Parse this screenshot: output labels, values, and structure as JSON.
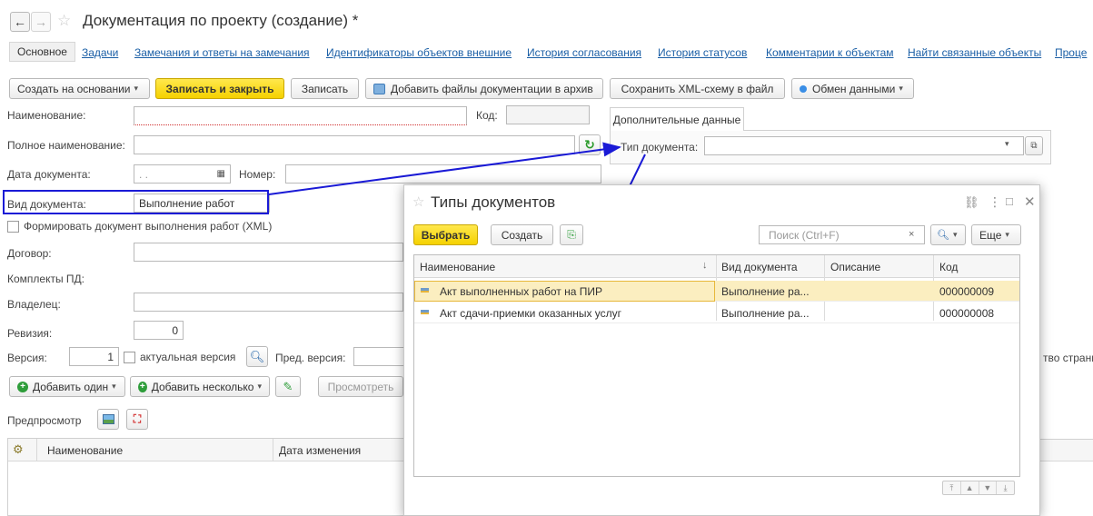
{
  "window": {
    "title": "Документация по проекту (создание) *",
    "back_glyph": "←",
    "forward_glyph": "→",
    "star_glyph": "☆"
  },
  "tabs": [
    {
      "label": "Основное",
      "active": true
    },
    {
      "label": "Задачи"
    },
    {
      "label": "Замечания и ответы на замечания"
    },
    {
      "label": "Идентификаторы объектов внешние"
    },
    {
      "label": "История согласования"
    },
    {
      "label": "История статусов"
    },
    {
      "label": "Комментарии к объектам"
    },
    {
      "label": "Найти связанные объекты"
    },
    {
      "label": "Проце"
    }
  ],
  "toolbar": {
    "create_based": "Создать на основании",
    "save_close": "Записать и закрыть",
    "save": "Записать",
    "add_files": "Добавить файлы документации в архив",
    "save_xml": "Сохранить XML-схему в файл",
    "exchange": "Обмен данными"
  },
  "form": {
    "name_label": "Наименование:",
    "code_label": "Код:",
    "full_name_label": "Полное наименование:",
    "doc_date_label": "Дата документа:",
    "doc_date_value": ". .",
    "number_label": "Номер:",
    "doc_kind_label": "Вид документа:",
    "doc_kind_value": "Выполнение работ",
    "form_xml_label": "Формировать документ выполнения работ (XML)",
    "contract_label": "Договор:",
    "kits_label": "Комплекты ПД:",
    "owner_label": "Владелец:",
    "revision_label": "Ревизия:",
    "revision_value": "0",
    "version_label": "Версия:",
    "version_value": "1",
    "actual_version_label": "актуальная версия",
    "prev_version_label": "Пред. версия:",
    "pages_label_partial": "тво страниц"
  },
  "additional": {
    "tab_label": "Дополнительные данные",
    "doc_type_label": "Тип документа:"
  },
  "files": {
    "add_one": "Добавить один",
    "add_several": "Добавить несколько",
    "view": "Просмотреть",
    "preview_label": "Предпросмотр",
    "col_name": "Наименование",
    "col_modified": "Дата изменения"
  },
  "dialog": {
    "title": "Типы документов",
    "select": "Выбрать",
    "create": "Создать",
    "search_placeholder": "Поиск (Ctrl+F)",
    "more": "Еще",
    "columns": [
      "Наименование",
      "Вид документа",
      "Описание",
      "Код"
    ],
    "rows": [
      {
        "name": "Акт выполненных работ на ПИР",
        "kind": "Выполнение ра...",
        "desc": "",
        "code": "000000009",
        "selected": true
      },
      {
        "name": "Акт сдачи-приемки оказанных услуг",
        "kind": "Выполнение ра...",
        "desc": "",
        "code": "000000008",
        "selected": false
      }
    ]
  },
  "colors": {
    "accent_yellow": "#f5d100",
    "link_blue": "#1b5fa6",
    "annotation_blue": "#1a1ad6",
    "selected_row": "#fbeec0"
  }
}
